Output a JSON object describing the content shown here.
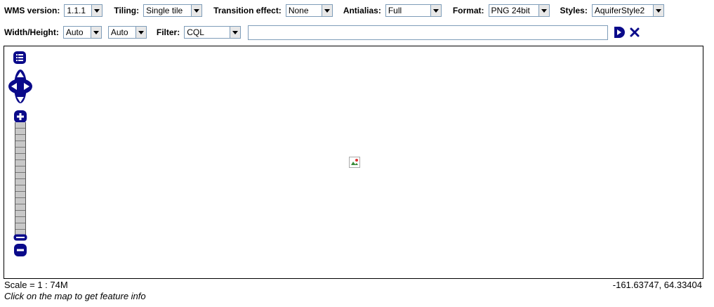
{
  "toolbar": {
    "wms_version": {
      "label": "WMS version:",
      "value": "1.1.1"
    },
    "tiling": {
      "label": "Tiling:",
      "value": "Single tile"
    },
    "transition": {
      "label": "Transition effect:",
      "value": "None"
    },
    "antialias": {
      "label": "Antialias:",
      "value": "Full"
    },
    "format": {
      "label": "Format:",
      "value": "PNG 24bit"
    },
    "styles": {
      "label": "Styles:",
      "value": "AquiferStyle2"
    },
    "size": {
      "label": "Width/Height:",
      "width": "Auto",
      "height": "Auto"
    },
    "filter": {
      "label": "Filter:",
      "type": "CQL",
      "query": ""
    }
  },
  "status": {
    "scale": "Scale = 1 : 74M",
    "hint": "Click on the map to get feature info",
    "coords": "-161.63747, 64.33404"
  },
  "colors": {
    "nav": "#0a0a8a"
  }
}
